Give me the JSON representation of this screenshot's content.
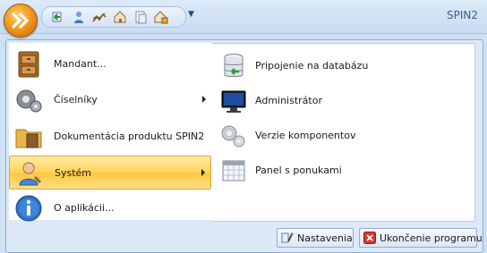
{
  "app": {
    "title": "SPIN2"
  },
  "qat": {
    "icons": [
      "back-arrow-icon",
      "user-icon",
      "chart-icon",
      "home-icon",
      "document-icon",
      "home-lock-icon"
    ]
  },
  "menu": {
    "items": [
      {
        "label": "Mandant...",
        "icon": "cabinet-icon"
      },
      {
        "label": "Číselníky",
        "icon": "gears-icon"
      },
      {
        "label": "Dokumentácia produktu SPIN2",
        "icon": "folder-icon"
      },
      {
        "label": "Systém",
        "icon": "user-system-icon"
      },
      {
        "label": "O aplikácii...",
        "icon": "info-icon"
      }
    ],
    "submenu": [
      {
        "label": "Pripojenie na databázu",
        "icon": "database-icon"
      },
      {
        "label": "Administrátor",
        "icon": "monitor-icon"
      },
      {
        "label": "Verzie komponentov",
        "icon": "components-icon"
      },
      {
        "label": "Panel s ponukami",
        "icon": "calendar-icon"
      }
    ],
    "buttons": {
      "settings": "Nastavenia",
      "exit": "Ukončenie programu"
    }
  },
  "colors": {
    "highlight": "#ffd35a",
    "frame": "#8eaad0",
    "exit_icon": "#d23b2f"
  }
}
